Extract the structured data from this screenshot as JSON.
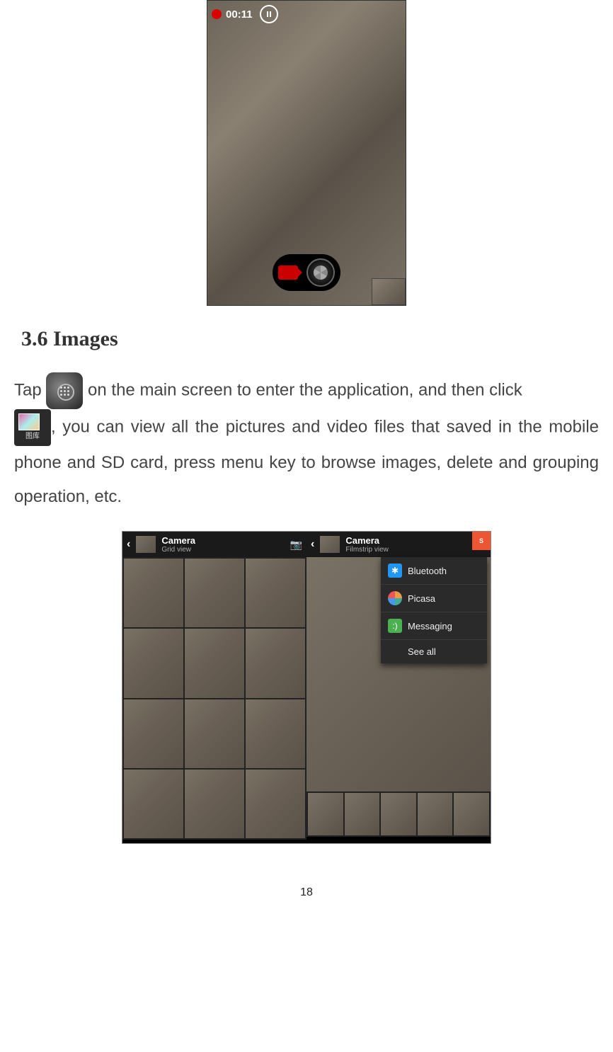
{
  "video_rec": {
    "time": "00:11"
  },
  "section": {
    "number": "3.6",
    "title": "Images"
  },
  "body": {
    "p1_a": "Tap ",
    "p1_b": " on the main screen to enter the application, and then click ",
    "p2": ", you can view all the pictures and video files that saved in the mobile phone and SD card, press menu key to browse images, delete and grouping operation, etc."
  },
  "gallery_icon_label": "图库",
  "gallery_left": {
    "title": "Camera",
    "subtitle": "Grid view"
  },
  "gallery_right": {
    "title": "Camera",
    "subtitle": "Filmstrip view"
  },
  "share_menu": {
    "items": [
      "Bluetooth",
      "Picasa",
      "Messaging",
      "See all"
    ]
  },
  "red_badge": "S",
  "page_number": "18"
}
